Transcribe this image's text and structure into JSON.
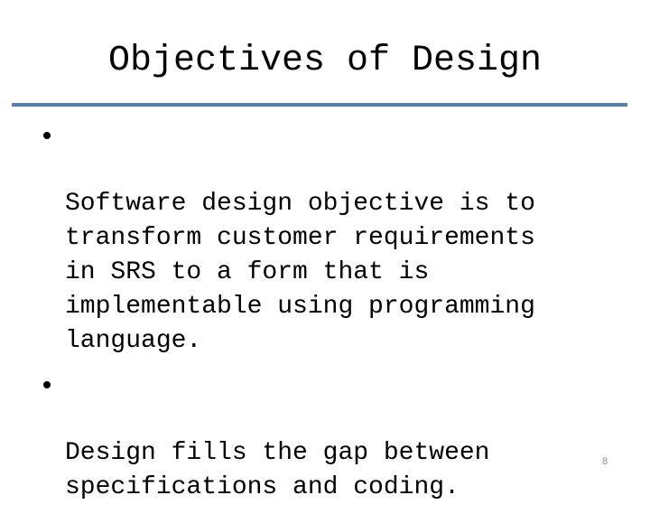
{
  "slide": {
    "title": "Objectives of Design",
    "bullets": [
      "Software design objective is to\ntransform customer requirements\nin SRS to a form that is\nimplementable using programming\nlanguage.",
      "Design fills the gap between\nspecifications and coding."
    ],
    "page_number": "8",
    "accent_color": "#5b7fa3"
  }
}
